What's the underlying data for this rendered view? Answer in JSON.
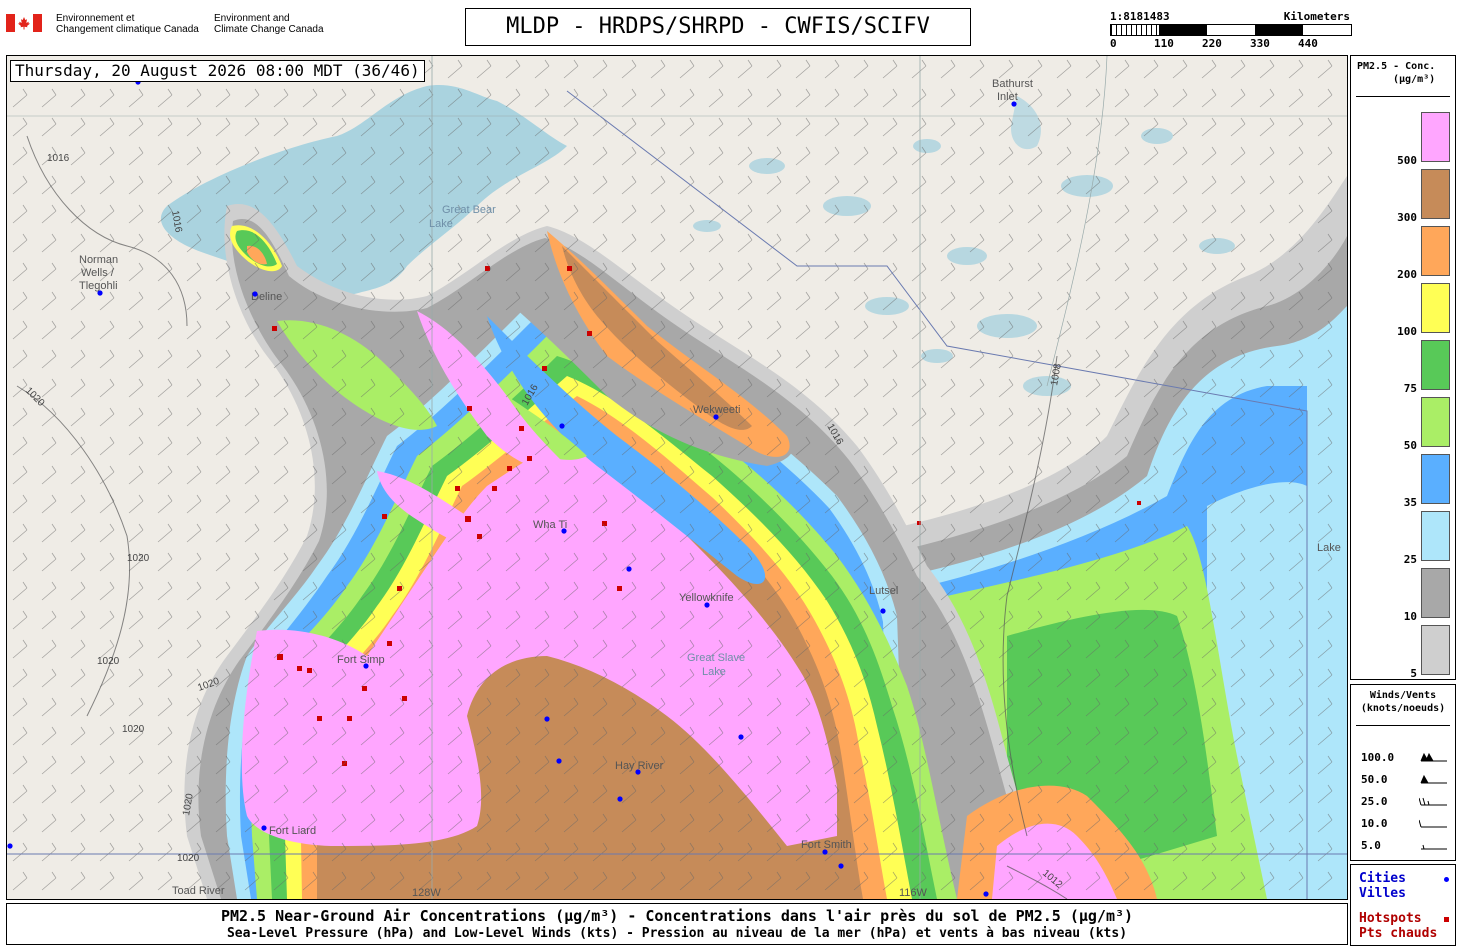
{
  "header": {
    "gov_fr_line1": "Environnement et",
    "gov_fr_line2": "Changement climatique Canada",
    "gov_en_line1": "Environment and",
    "gov_en_line2": "Climate Change Canada",
    "title": "MLDP - HRDPS/SHRPD - CWFIS/SCIFV"
  },
  "scale": {
    "ratio": "1:8181483",
    "units": "Kilometers",
    "ticks": [
      "0",
      "110",
      "220",
      "330",
      "440"
    ]
  },
  "map": {
    "timestamp": "Thursday, 20 August 2026 08:00 MDT (36/46)",
    "labels": {
      "great_bear_lake": [
        "Great Bear",
        "Lake"
      ],
      "great_slave_lake": [
        "Great Slave",
        "Lake"
      ],
      "norman_wells": [
        "Norman",
        "Wells /",
        "Tlegohli"
      ],
      "bathurst_inlet": [
        "Bathurst",
        "Inlet"
      ],
      "deline": "Deline",
      "wekweeti": "Wekweeti",
      "wha_ti": "Wha Ti",
      "yellowknife": "Yellowknife",
      "lutselke": "Lutsel",
      "fort_simpson": "Fort Simp",
      "hay_river": "Hay River",
      "fort_liard": "Fort Liard",
      "fort_smith": "Fort Smith",
      "toad_river": "Toad River",
      "lake": "Lake",
      "meridian_128": "128W",
      "meridian_116": "116W"
    },
    "isobars": [
      "1016",
      "1016",
      "1020",
      "1020",
      "1020",
      "1020",
      "1020",
      "1020",
      "1020",
      "1012",
      "1008",
      "1016",
      "1016"
    ],
    "colors": {
      "land": "#efece6",
      "water": "#aad3df",
      "city": "#0000ff",
      "hotspot": "#cc0000"
    }
  },
  "legend": {
    "title_line1": "PM2.5 - Conc.",
    "title_line2": "(µg/m³)",
    "levels": [
      {
        "value": "500",
        "color": "#ffa6ff"
      },
      {
        "value": "300",
        "color": "#c68b59"
      },
      {
        "value": "200",
        "color": "#ffa75a"
      },
      {
        "value": "100",
        "color": "#ffff55"
      },
      {
        "value": "75",
        "color": "#58c958"
      },
      {
        "value": "50",
        "color": "#aaee66"
      },
      {
        "value": "35",
        "color": "#5aafff"
      },
      {
        "value": "25",
        "color": "#aee6fa"
      },
      {
        "value": "10",
        "color": "#a8a8a8"
      },
      {
        "value": "5",
        "color": "#cfcfcf"
      }
    ]
  },
  "wind_legend": {
    "title_line1": "Winds/Vents",
    "title_line2": "(knots/noeuds)",
    "rows": [
      "100.0",
      "50.0",
      "25.0",
      "10.0",
      "5.0"
    ]
  },
  "cities_legend": {
    "cities_en": "Cities",
    "cities_fr": "Villes",
    "hotspots_en": "Hotspots",
    "hotspots_fr": "Pts chauds"
  },
  "footer": {
    "line1": "PM2.5 Near-Ground Air Concentrations (µg/m³) - Concentrations dans l'air près du sol de PM2.5 (µg/m³)",
    "line2": "Sea-Level Pressure (hPa) and Low-Level Winds (kts) - Pression au niveau de la mer (hPa) et vents à bas niveau (kts)"
  }
}
